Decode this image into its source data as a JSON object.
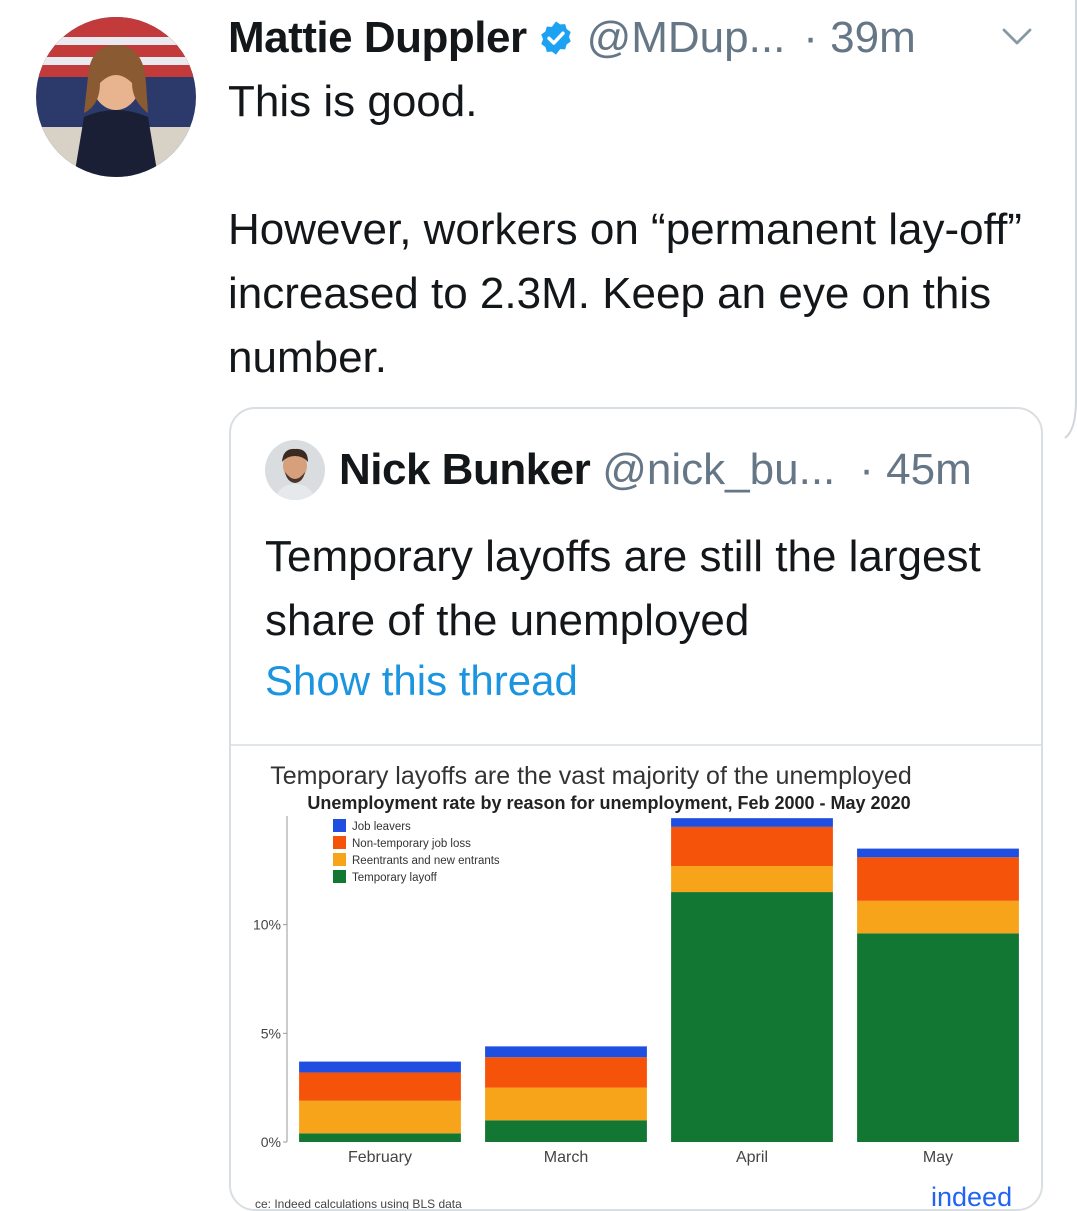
{
  "tweet": {
    "author_name": "Mattie Duppler",
    "handle": "@MDup...",
    "time": "· 39m",
    "text": "This is good.\n\nHowever, workers on “permanent lay-off” increased to 2.3M. Keep an eye on this number."
  },
  "quoted_tweet": {
    "author_name": "Nick Bunker",
    "handle": "@nick_bu...",
    "time": "· 45m",
    "text": "Temporary layoffs are still the largest share of the unemployed",
    "show_thread": "Show this thread"
  },
  "colors": {
    "job_leavers": "#1f4fe0",
    "non_temporary": "#f5520a",
    "reentrants": "#f7a41a",
    "temporary": "#117733",
    "link": "#1b95e0",
    "verified": "#1da1f2"
  },
  "chart_data": {
    "type": "bar",
    "stacked": true,
    "title": "Temporary layoffs are the vast majority of the unemployed",
    "subtitle": "Unemployment rate by reason for unemployment, Feb 2000 - May 2020",
    "categories": [
      "February",
      "March",
      "April",
      "May"
    ],
    "series": [
      {
        "name": "Temporary layoff",
        "color": "#117733",
        "values": [
          0.4,
          1.0,
          11.5,
          9.6
        ]
      },
      {
        "name": "Reentrants and new entrants",
        "color": "#f7a41a",
        "values": [
          1.5,
          1.5,
          1.2,
          1.5
        ]
      },
      {
        "name": "Non-temporary job loss",
        "color": "#f5520a",
        "values": [
          1.3,
          1.4,
          1.8,
          2.0
        ]
      },
      {
        "name": "Job leavers",
        "color": "#1f4fe0",
        "values": [
          0.5,
          0.5,
          0.4,
          0.4
        ]
      }
    ],
    "legend_order": [
      "Job leavers",
      "Non-temporary job loss",
      "Reentrants and new entrants",
      "Temporary layoff"
    ],
    "y_ticks": [
      "0%",
      "5%",
      "10%"
    ],
    "y_tick_values": [
      0,
      5,
      10
    ],
    "ylim": [
      0,
      15
    ],
    "legend_position": "top-left",
    "source_text": "ce: Indeed calculations using BLS data",
    "logo_text": "indeed"
  }
}
